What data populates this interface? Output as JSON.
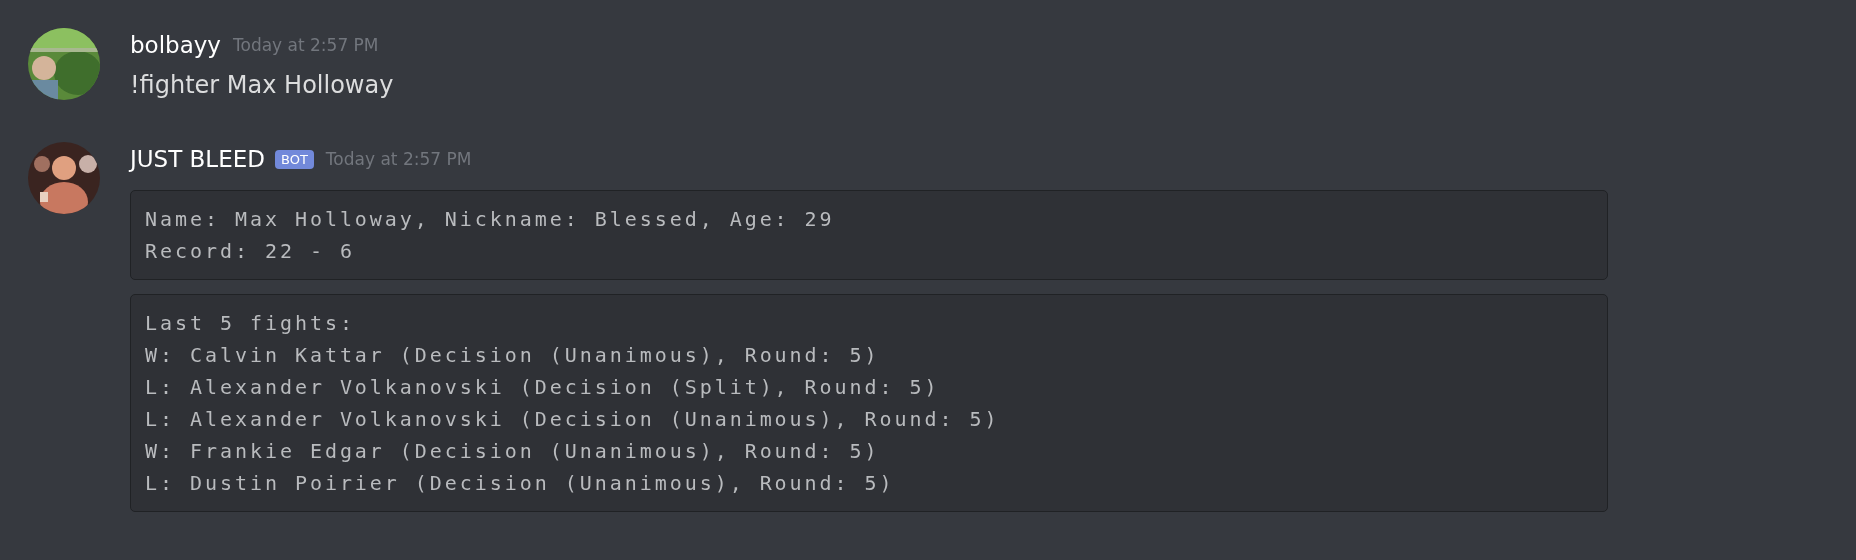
{
  "messages": [
    {
      "author": "bolbayy",
      "bot": false,
      "timestamp": "Today at 2:57 PM",
      "text": "!fighter Max Holloway"
    },
    {
      "author": "JUST BLEED",
      "bot": true,
      "badge": "BOT",
      "timestamp": "Today at 2:57 PM",
      "code_blocks": [
        {
          "lines": [
            "Name: Max Holloway, Nickname: Blessed, Age: 29",
            "Record: 22 - 6"
          ]
        },
        {
          "lines": [
            "Last 5 fights:",
            "W: Calvin Kattar (Decision (Unanimous), Round: 5)",
            "L: Alexander Volkanovski (Decision (Split), Round: 5)",
            "L: Alexander Volkanovski (Decision (Unanimous), Round: 5)",
            "W: Frankie Edgar (Decision (Unanimous), Round: 5)",
            "L: Dustin Poirier (Decision (Unanimous), Round: 5)"
          ]
        }
      ]
    }
  ]
}
